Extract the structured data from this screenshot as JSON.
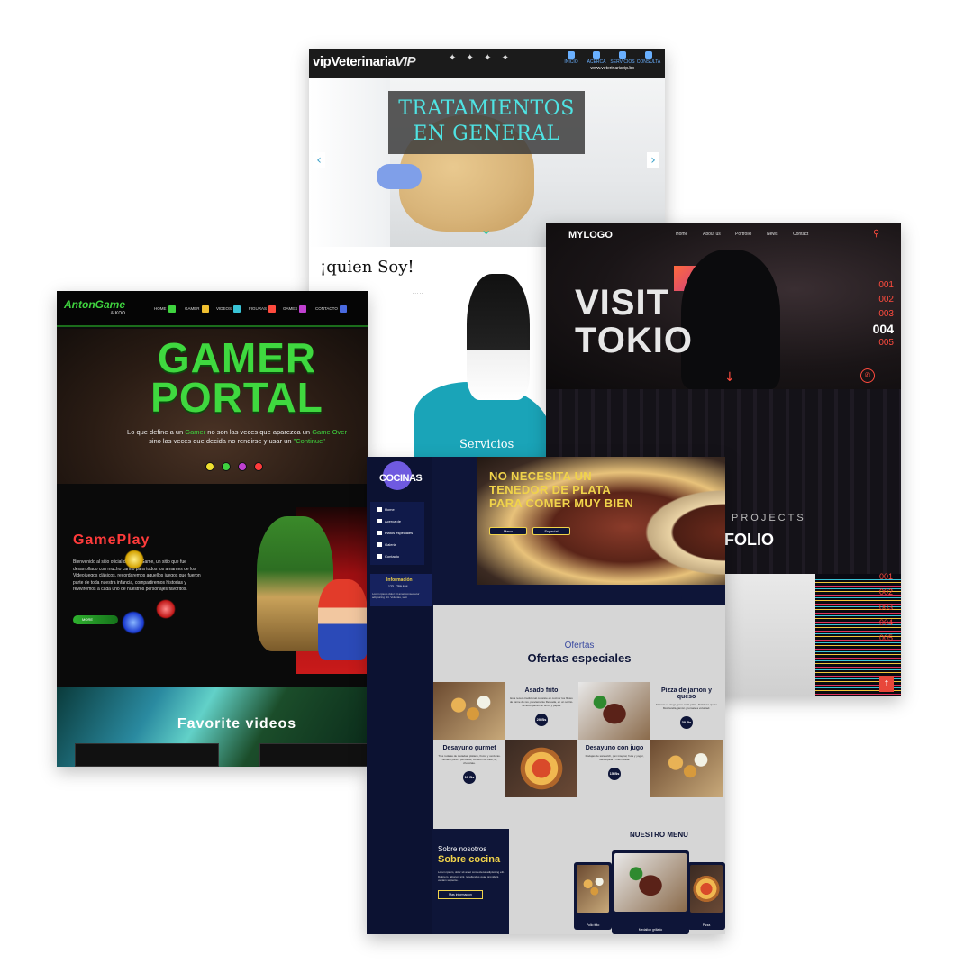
{
  "vet": {
    "logo_prefix": "vip",
    "logo_main": "Veterinaria",
    "logo_suffix": "VIP",
    "nav": [
      "INICIO",
      "ACERCA",
      "SERVICIOS",
      "CONSULTA"
    ],
    "url": "www.veterinariavip.bo",
    "hero_title": "TRATAMIENTOS EN GENERAL",
    "about_title": "¡quien Soy!",
    "services_label": "Servicios"
  },
  "tokio": {
    "logo": "MYLOGO",
    "nav": [
      "Home",
      "About us",
      "Portfolio",
      "News",
      "Contact"
    ],
    "hero_line1": "VISIT",
    "hero_line2": "TOKIO",
    "slides": [
      "001",
      "002",
      "003",
      "004",
      "005"
    ],
    "active_slide": "004",
    "projects_label": "PROJECTS",
    "folio_label": "FOLIO",
    "slides2": [
      "001",
      "002",
      "003",
      "004",
      "005"
    ]
  },
  "gamer": {
    "logo": "AntonGame",
    "logo_sub": "& KOO",
    "nav": [
      "HOME",
      "GAMER",
      "VIDEOS",
      "FIGURAS",
      "GAMES",
      "CONTACTO"
    ],
    "facebook": "Facebook",
    "title_line1": "GAMER",
    "title_line2": "PORTAL",
    "tagline_a": "Lo que define a un ",
    "tagline_b": "Gamer",
    "tagline_c": " no son las veces que aparezca un ",
    "tagline_d": "Game Over",
    "tagline_e": "sino las veces que decida no rendirse y usar un ",
    "tagline_f": "\"Continue\"",
    "gameplay_title": "GamePlay",
    "gameplay_text": "Bienvenido al sitio oficial de AntonGame, un sitio que fue desarrollado con mucho cariño para todos los amantes de los Videojuegos clásicos, recordaremos aquellos juegos que fueron parte de toda nuestra infancia, compartiremos historias y reviviremos a cada uno de nuestros personajes favoritos.",
    "more_label": "MORE",
    "favorite_title": "Favorite videos"
  },
  "cocinas": {
    "logo": "COCINAS",
    "side_menu": [
      "Home",
      "Acerca de",
      "Platos especiales",
      "Galeria",
      "Contacto"
    ],
    "info_title": "Información",
    "info_phone": "123 - 789 654",
    "info_text": "Lorem ipsum dolor sit amet consectetur adipisicing elit. Voluptas, sed.",
    "hero_line1": "NO NECESITA UN",
    "hero_line2": "TENEDOR DE PLATA",
    "hero_line3": "PARA COMER MUY BIEN",
    "hero_btn1": "Menu",
    "hero_btn2": "Especial",
    "offers_sub": "Ofertas",
    "offers_title": "Ofertas especiales",
    "dishes": [
      {
        "name": "Asado frito",
        "desc": "Esta receta tradicional consiste en cocinar los filetes de carne de res, previamente fileteada, en un sofrito. Se acompaña con arroz y papas.",
        "price": "20 Bs"
      },
      {
        "name": "Pizza de jamon y queso",
        "desc": "El amor es ciego, pero no la pizza. Deliciosa queso Mozzarella, jamón y tomate a voluntad.",
        "price": "30 Bs"
      },
      {
        "name": "Desayuno gurmet",
        "desc": "Tres rodajas de tostadas, plátano, frutos y verduras. Tamaño para 2 personas, cómelo con café, té, chocolate.",
        "price": "10 Bs"
      },
      {
        "name": "Desayuno con jugo",
        "desc": "Rodajas de sándwich, pan integral, fruta y yogur, mantequilla y mermelada.",
        "price": "15 Bs"
      }
    ],
    "about_sub": "Sobre nosotros",
    "about_title": "Sobre cocina",
    "about_text": "Lorem ipsum, dolor sit amet consectetur adipisicing elit. Dolorem, laborum sint, repellendus quae provident, veniam sapiente.",
    "about_btn": "Mas informacion",
    "menu_title": "NUESTRO MENU",
    "menu_items": [
      "Pollo frito",
      "Medallon grillado",
      "Pizza"
    ]
  }
}
